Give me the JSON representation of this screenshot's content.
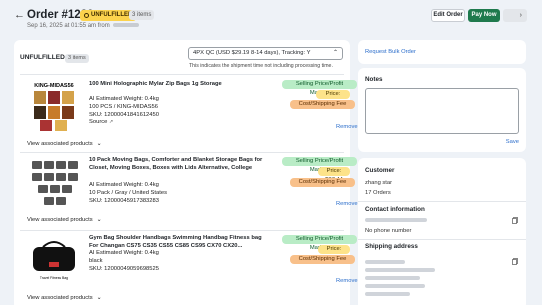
{
  "header": {
    "back_glyph": "←",
    "title": "Order #1220",
    "status_badge": "UNFULFILLED",
    "items_badge": "3 items",
    "date_text": "Sep 16, 2025 at 01:55 am from",
    "edit_label": "Edit Order",
    "pay_label": "Pay Now",
    "nav_glyph": "›"
  },
  "fulfillment": {
    "label": "UNFULFILLED",
    "count": "3 items",
    "shipping_option": "4PX QC (USD $29.19 8-14 days), Tracking: Y",
    "shipping_note": "This indicates the shipment time not including processing time."
  },
  "products": [
    {
      "thumb_text": "KING-MIDAS56",
      "title": "100 Mini Holographic Mylar Zip Bags 1g Storage",
      "weight": "AI Estimated Weight: 0.4kg",
      "variant": "100 PCS / KING-MIDAS56",
      "sku": "SKU: 12000041841612450",
      "source": "Source",
      "tag_price_markup": "Selling Price/Profit Markup",
      "price": "Price: $541.12",
      "tag_cost": "Cost/Shipping Fee",
      "remove": "Remove",
      "view_assoc": "View associated products"
    },
    {
      "thumb_text": "",
      "title": "10 Pack Moving Bags, Comforter and Blanket Storage Bags for Closet, Moving Boxes, Boxes with Lids Alternative, College",
      "weight": "AI Estimated Weight: 0.4kg",
      "variant": "10 Pack / Gray / United States",
      "sku": "SKU: 12000045917383283",
      "source": "Source",
      "tag_price_markup": "Selling Price/Profit Markup",
      "price": "Price: $87.44",
      "tag_cost": "Cost/Shipping Fee",
      "remove": "Remove",
      "view_assoc": "View associated products"
    },
    {
      "thumb_text": "Travel Fitness Bag",
      "title": "Gym Bag Shoulder Handbags Swimming Handbag Fitness bag For Changan CS75 CS35 CS55 CS85 CS95 CX70 CX20...",
      "weight": "AI Estimated Weight: 0.4kg",
      "variant": "black",
      "sku": "SKU: 12000049059698525",
      "source": "Source",
      "tag_price_markup": "Selling Price/Profit Markup",
      "price": "Price: $54.98",
      "tag_cost": "Cost/Shipping Fee",
      "remove": "Remove",
      "view_assoc": "View associated products"
    }
  ],
  "sidebar": {
    "request_bulk": "Request Bulk Order",
    "notes_title": "Notes",
    "save": "Save",
    "customer_title": "Customer",
    "customer_name": "zhang star",
    "customer_orders": "17 Orders",
    "contact_title": "Contact information",
    "contact_phone": "No phone number",
    "shipping_title": "Shipping address"
  },
  "colors": {
    "accent_link": "#2c6ecb",
    "pay_button": "#1f7a4d",
    "status_badge": "#fcd34d",
    "tag_green": "#b9ecc6",
    "tag_yellow": "#fde38a",
    "tag_orange": "#f8c08a"
  }
}
